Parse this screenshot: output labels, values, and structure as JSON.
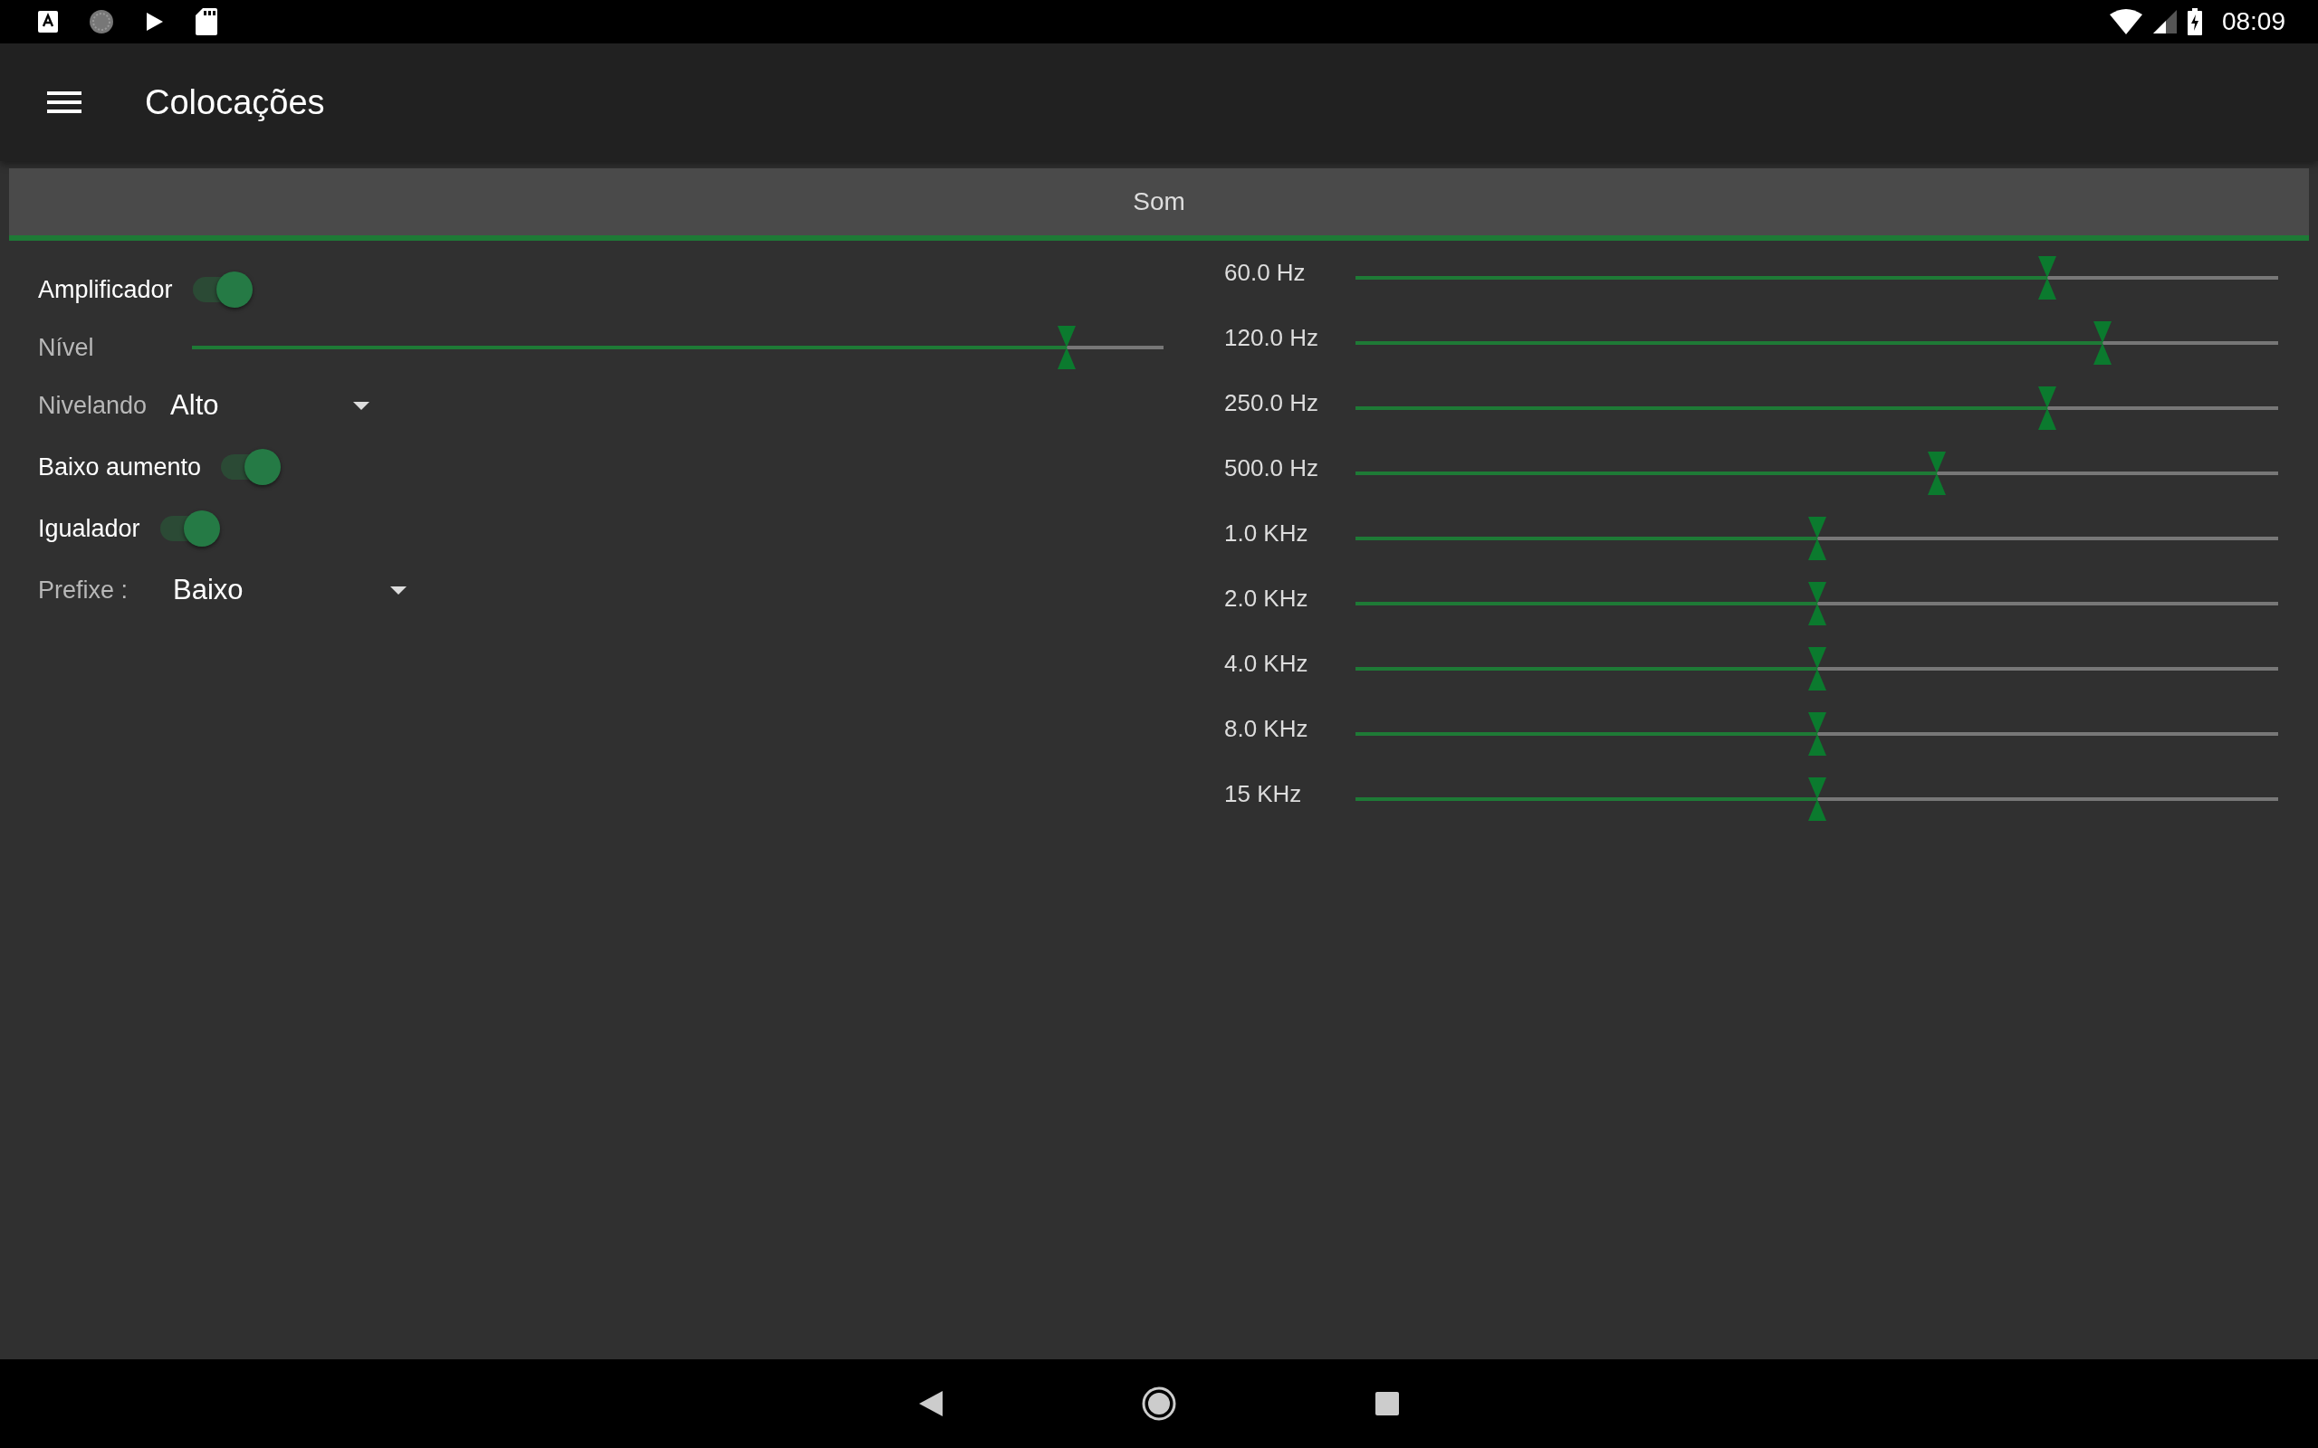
{
  "status_bar": {
    "time": "08:09"
  },
  "toolbar": {
    "title": "Colocações"
  },
  "tabs": [
    {
      "label": "Som",
      "selected": true
    }
  ],
  "settings": [
    {
      "kind": "switch",
      "label": "Amplificador",
      "on": true
    },
    {
      "kind": "slider",
      "label": "Nível",
      "level": 0.9
    },
    {
      "kind": "dropdown",
      "label": "Nivelando",
      "value": "Alto"
    },
    {
      "kind": "switch",
      "label": "Baixo aumento",
      "on": true
    },
    {
      "kind": "switch",
      "label": "Igualador",
      "on": true
    },
    {
      "kind": "dropdown",
      "label": "Prefixe :",
      "value": "Baixo"
    }
  ],
  "equalizer": [
    {
      "label": "60.0 Hz",
      "level": 0.75
    },
    {
      "label": "120.0 Hz",
      "level": 0.81
    },
    {
      "label": "250.0 Hz",
      "level": 0.75
    },
    {
      "label": "500.0 Hz",
      "level": 0.63
    },
    {
      "label": "1.0 KHz",
      "level": 0.5
    },
    {
      "label": "2.0 KHz",
      "level": 0.5
    },
    {
      "label": "4.0 KHz",
      "level": 0.5
    },
    {
      "label": "8.0 KHz",
      "level": 0.5
    },
    {
      "label": "15 KHz",
      "level": 0.5
    }
  ]
}
